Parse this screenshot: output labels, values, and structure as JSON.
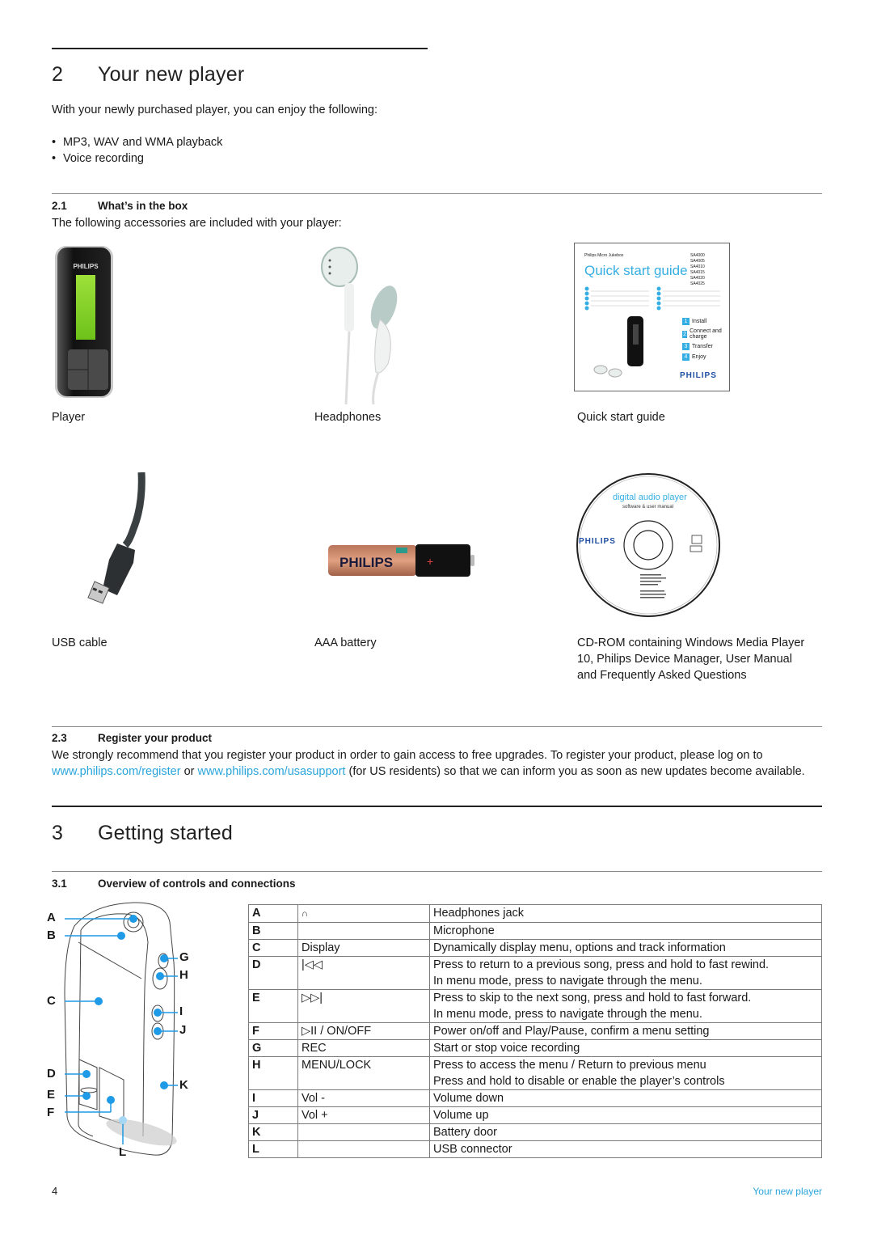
{
  "chapter2": {
    "number": "2",
    "title": "Your new player",
    "intro": "With your newly purchased player, you can enjoy the following:",
    "features": [
      "MP3, WAV and WMA playback",
      "Voice recording"
    ]
  },
  "section21": {
    "number": "2.1",
    "title": "What’s in the box",
    "intro": "The following accessories are included with your player:",
    "items": [
      {
        "caption": "Player",
        "icon": "player-image"
      },
      {
        "caption": "Headphones",
        "icon": "headphones-image"
      },
      {
        "caption": "Quick start guide",
        "icon": "quick-start-guide-image"
      },
      {
        "caption": "USB cable",
        "icon": "usb-cable-image"
      },
      {
        "caption": "AAA battery",
        "icon": "aaa-battery-image"
      },
      {
        "caption": "CD-ROM containing Windows Media Player 10, Philips Device Manager, User Manual and Frequently Asked Questions",
        "icon": "cd-rom-image"
      }
    ]
  },
  "qsg": {
    "brand_line": "Philips Micro Jukebox",
    "title": "Quick start guide",
    "models": [
      "SA4000",
      "SA4005",
      "SA4010",
      "SA4015",
      "SA4020",
      "SA4025"
    ],
    "steps": [
      {
        "n": "1",
        "label": "Install"
      },
      {
        "n": "2",
        "label": "Connect and charge"
      },
      {
        "n": "3",
        "label": "Transfer"
      },
      {
        "n": "4",
        "label": "Enjoy"
      }
    ],
    "logo": "PHILIPS"
  },
  "cd": {
    "title": "digital audio player",
    "subtitle": "software & user manual",
    "logo": "PHILIPS"
  },
  "battery": {
    "logo": "PHILIPS"
  },
  "player_image": {
    "logo": "PHILIPS"
  },
  "section23": {
    "number": "2.3",
    "title": "Register your product",
    "text_before": "We strongly recommend that you register your product in order to gain access to free upgrades. To register your product, please log on to ",
    "link1": "www.philips.com/register",
    "text_mid": " or ",
    "link2": "www.philips.com/usasupport",
    "text_after": " (for US residents) so that we can inform you as soon as new updates become available."
  },
  "chapter3": {
    "number": "3",
    "title": "Getting started"
  },
  "section31": {
    "number": "3.1",
    "title": "Overview of controls and connections",
    "diagram_labels": [
      "A",
      "B",
      "C",
      "D",
      "E",
      "F",
      "G",
      "H",
      "I",
      "J",
      "K",
      "L"
    ],
    "controls": [
      {
        "key": "A",
        "symbol": "🎧",
        "symbol_icon": "headphones-icon",
        "desc": [
          "Headphones jack"
        ]
      },
      {
        "key": "B",
        "symbol": "",
        "desc": [
          "Microphone"
        ]
      },
      {
        "key": "C",
        "symbol": "Display",
        "desc": [
          "Dynamically display menu, options and track information"
        ]
      },
      {
        "key": "D",
        "symbol": "|◁◁",
        "symbol_icon": "previous-icon",
        "desc": [
          "Press to return to a previous song, press and hold to fast rewind.",
          "In menu mode, press to navigate through the menu."
        ]
      },
      {
        "key": "E",
        "symbol": "▷▷|",
        "symbol_icon": "next-icon",
        "desc": [
          "Press to skip to the next song, press and hold to fast forward.",
          "In menu mode, press to navigate through the menu."
        ]
      },
      {
        "key": "F",
        "symbol": "▷II / ON/OFF",
        "symbol_icon": "play-pause-icon",
        "desc": [
          "Power on/off and Play/Pause, confirm a menu setting"
        ]
      },
      {
        "key": "G",
        "symbol": "REC",
        "desc": [
          "Start or stop voice recording"
        ]
      },
      {
        "key": "H",
        "symbol": "MENU/LOCK",
        "desc": [
          "Press to access the menu / Return to previous menu",
          "Press and hold to disable or enable the player’s controls"
        ]
      },
      {
        "key": "I",
        "symbol": "Vol -",
        "desc": [
          "Volume down"
        ]
      },
      {
        "key": "J",
        "symbol": "Vol +",
        "desc": [
          "Volume up"
        ]
      },
      {
        "key": "K",
        "symbol": "",
        "desc": [
          "Battery door"
        ]
      },
      {
        "key": "L",
        "symbol": "",
        "desc": [
          "USB connector"
        ]
      }
    ]
  },
  "footer": {
    "page_number": "4",
    "running_title": "Your new player"
  },
  "colors": {
    "accent": "#2aa5dc",
    "philips_blue": "#1f4fa2",
    "callout_blue": "#1e9ae6"
  }
}
